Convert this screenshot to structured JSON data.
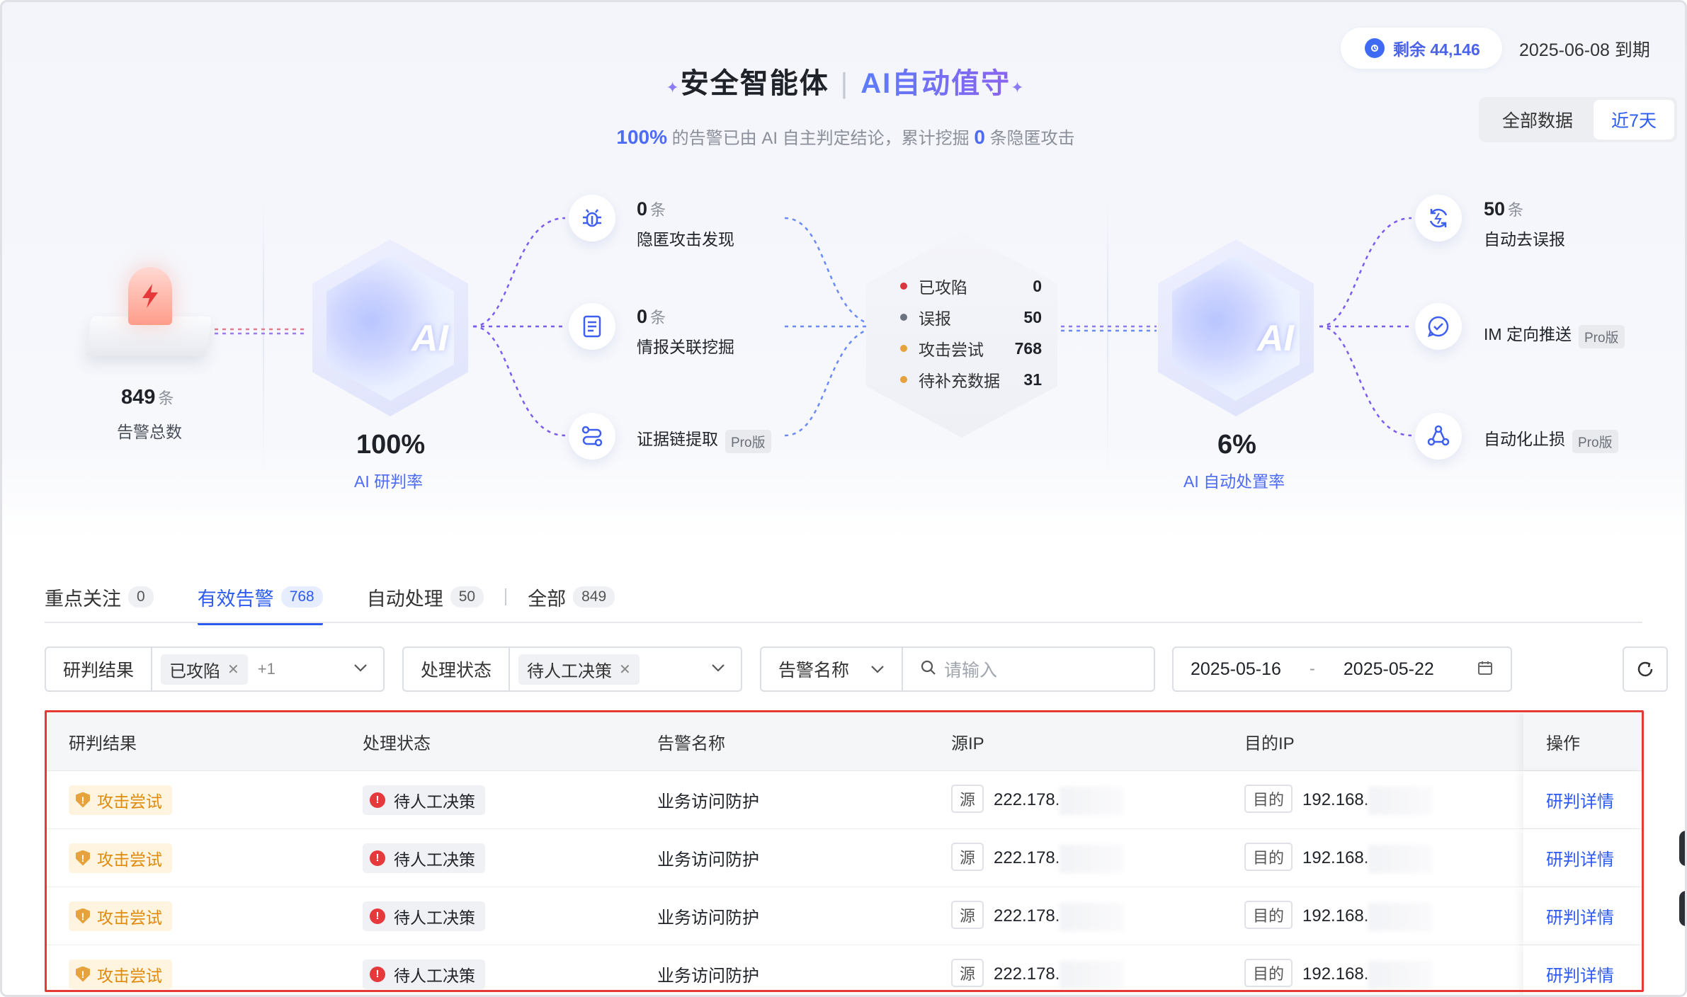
{
  "header": {
    "title_main": "安全智能体",
    "title_sub": "AI自动值守",
    "subtitle_pct": "100%",
    "subtitle_mid": " 的告警已由 AI 自主判定结论，累计挖掘 ",
    "subtitle_num": "0",
    "subtitle_end": " 条隐匿攻击",
    "quota": "剩余 44,146",
    "expire": "2025-06-08 到期",
    "range_options": [
      "全部数据",
      "近7天"
    ],
    "range_selected": "近7天"
  },
  "flow": {
    "total": {
      "value": "849",
      "unit": "条",
      "label": "告警总数"
    },
    "ai_judge": {
      "value": "100%",
      "label": "AI 研判率"
    },
    "ai_dispose": {
      "value": "6%",
      "label": "AI 自动处置率"
    },
    "left_nodes": [
      {
        "num": "0",
        "unit": "条",
        "title": "隐匿攻击发现",
        "icon": "bug-icon"
      },
      {
        "num": "0",
        "unit": "条",
        "title": "情报关联挖掘",
        "icon": "document-icon"
      },
      {
        "title": "证据链提取",
        "pro": "Pro版",
        "icon": "route-icon"
      }
    ],
    "stats": [
      {
        "label": "已攻陷",
        "value": "0",
        "color": "#d9363e"
      },
      {
        "label": "误报",
        "value": "50",
        "color": "#6b7280"
      },
      {
        "label": "攻击尝试",
        "value": "768",
        "color": "#e6a23c"
      },
      {
        "label": "待补充数据",
        "value": "31",
        "color": "#e6a23c"
      }
    ],
    "right_nodes": [
      {
        "num": "50",
        "unit": "条",
        "title": "自动去误报",
        "icon": "refresh-bolt-icon"
      },
      {
        "title": "IM 定向推送",
        "pro": "Pro版",
        "icon": "chat-check-icon"
      },
      {
        "title": "自动化止损",
        "pro": "Pro版",
        "icon": "nodes-icon"
      }
    ]
  },
  "tabs": [
    {
      "label": "重点关注",
      "count": "0"
    },
    {
      "label": "有效告警",
      "count": "768"
    },
    {
      "label": "自动处理",
      "count": "50"
    },
    {
      "label": "全部",
      "count": "849"
    }
  ],
  "filters": {
    "judge": {
      "label": "研判结果",
      "chip": "已攻陷",
      "more": "+1"
    },
    "status": {
      "label": "处理状态",
      "chip": "待人工决策"
    },
    "alert_name": {
      "label": "告警名称",
      "placeholder": "请输入"
    },
    "date_from": "2025-05-16",
    "date_sep": "-",
    "date_to": "2025-05-22"
  },
  "table": {
    "headers": [
      "研判结果",
      "处理状态",
      "告警名称",
      "源IP",
      "目的IP",
      "操作"
    ],
    "rows": [
      {
        "judge": "攻击尝试",
        "status": "待人工决策",
        "name": "业务访问防护",
        "src_tag": "源",
        "src_ip": "222.178.",
        "dst_tag": "目的",
        "dst_ip": "192.168.",
        "op": "研判详情"
      },
      {
        "judge": "攻击尝试",
        "status": "待人工决策",
        "name": "业务访问防护",
        "src_tag": "源",
        "src_ip": "222.178.",
        "dst_tag": "目的",
        "dst_ip": "192.168.",
        "op": "研判详情"
      },
      {
        "judge": "攻击尝试",
        "status": "待人工决策",
        "name": "业务访问防护",
        "src_tag": "源",
        "src_ip": "222.178.",
        "dst_tag": "目的",
        "dst_ip": "192.168.",
        "op": "研判详情"
      },
      {
        "judge": "攻击尝试",
        "status": "待人工决策",
        "name": "业务访问防护",
        "src_tag": "源",
        "src_ip": "222.178.",
        "dst_tag": "目的",
        "dst_ip": "192.168.",
        "op": "研判详情"
      }
    ]
  }
}
